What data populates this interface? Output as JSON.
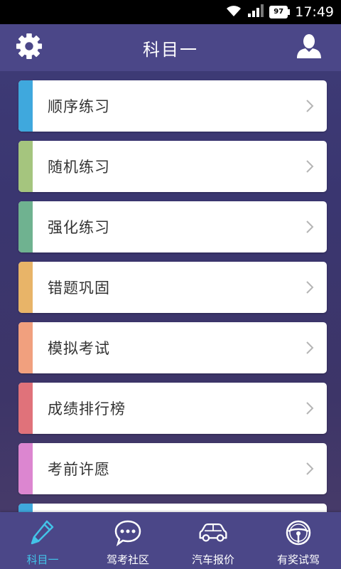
{
  "status_bar": {
    "time": "17:49",
    "battery": "97"
  },
  "header": {
    "title": "科目一",
    "settings_icon": "gear-icon",
    "user_icon": "user-icon"
  },
  "menu": {
    "items": [
      {
        "label": "顺序练习",
        "accent": "#3fa8dd"
      },
      {
        "label": "随机练习",
        "accent": "#a5c57e"
      },
      {
        "label": "强化练习",
        "accent": "#6fb290"
      },
      {
        "label": "错题巩固",
        "accent": "#e8b468"
      },
      {
        "label": "模拟考试",
        "accent": "#f1a07e"
      },
      {
        "label": "成绩排行榜",
        "accent": "#e0727a"
      },
      {
        "label": "考前许愿",
        "accent": "#dc86d0"
      },
      {
        "label": "",
        "accent": "#3fa8dd"
      }
    ]
  },
  "bottom_nav": {
    "items": [
      {
        "label": "科目一",
        "icon": "pencil-icon",
        "active": true
      },
      {
        "label": "驾考社区",
        "icon": "chat-bubble-icon",
        "active": false
      },
      {
        "label": "汽车报价",
        "icon": "car-icon",
        "active": false
      },
      {
        "label": "有奖试驾",
        "icon": "steering-wheel-icon",
        "active": false
      }
    ],
    "active_color": "#43c3e8"
  }
}
